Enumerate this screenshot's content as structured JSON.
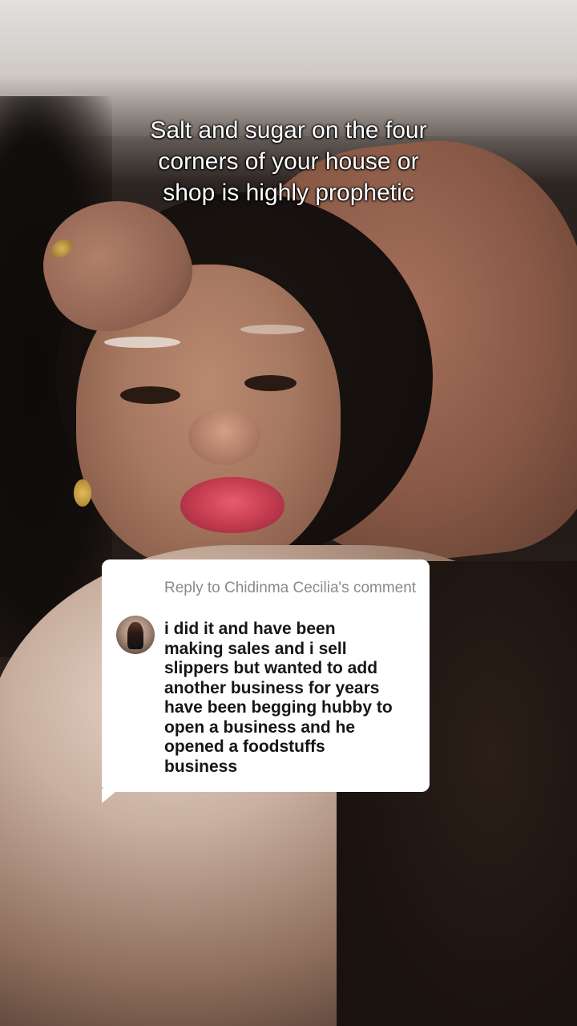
{
  "caption": {
    "lines": [
      "Salt and sugar on the four",
      "corners of your house or",
      "shop is highly prophetic"
    ]
  },
  "reply": {
    "header": "Reply to Chidinma Cecilia's comment",
    "comment_lines": [
      "i did it and have been",
      "making sales and i sell",
      "slippers but wanted to add",
      "another business for years",
      "have been begging hubby to",
      "open a business and he",
      "opened a foodstuffs",
      "business"
    ]
  },
  "colors": {
    "bubble_background": "#ffffff",
    "header_text": "#8a8a8a",
    "comment_text": "#161616",
    "caption_text": "#ffffff"
  }
}
